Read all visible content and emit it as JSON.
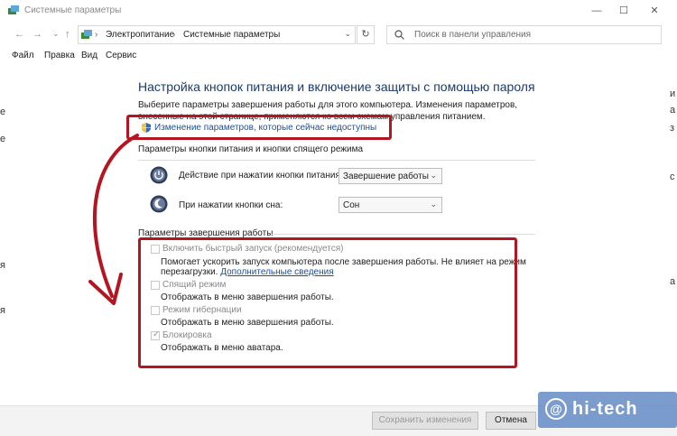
{
  "window": {
    "title": "Системные параметры",
    "controls": {
      "minimize": "—",
      "maximize": "☐",
      "close": "✕"
    }
  },
  "nav": {
    "back": "←",
    "forward": "→",
    "dropdown": "⌄",
    "up": "↑",
    "breadcrumb": [
      "Электропитание",
      "Системные параметры"
    ],
    "breadcrumb_sep": "›",
    "addr_dropdown": "⌄",
    "refresh": "↻"
  },
  "search": {
    "placeholder": "Поиск в панели управления"
  },
  "menu": [
    "Файл",
    "Правка",
    "Вид",
    "Сервис"
  ],
  "edge_left": [
    "е",
    "е",
    "я",
    "я"
  ],
  "edge_right": [
    "и",
    "а",
    "з",
    "с",
    "а"
  ],
  "page": {
    "title": "Настройка кнопок питания и включение защиты с помощью пароля",
    "intro": "Выберите параметры завершения работы для этого компьютера. Изменения параметров, внесенные на этой странице, применяются ко всем схемам управления питанием.",
    "change_link": "Изменение параметров, которые сейчас недоступны"
  },
  "power_buttons": {
    "header": "Параметры кнопки питания и кнопки спящего режима",
    "power": {
      "label": "Действие при нажатии кнопки питания:",
      "value": "Завершение работы"
    },
    "sleep": {
      "label": "При нажатии кнопки сна:",
      "value": "Сон"
    },
    "chevron": "⌄"
  },
  "shutdown": {
    "header": "Параметры завершения работы",
    "fast_startup": {
      "label": "Включить быстрый запуск (рекомендуется)",
      "desc1": "Помогает ускорить запуск компьютера после завершения работы. Не влияет на режим",
      "desc2": "перезагрузки.",
      "more": "Дополнительные сведения",
      "checked": false
    },
    "sleep": {
      "label": "Спящий режим",
      "desc": "Отображать в меню завершения работы.",
      "checked": false
    },
    "hibernate": {
      "label": "Режим гибернации",
      "desc": "Отображать в меню завершения работы.",
      "checked": false
    },
    "lock": {
      "label": "Блокировка",
      "desc": "Отображать в меню аватара.",
      "checked": true,
      "check_glyph": "✓"
    }
  },
  "footer": {
    "save": "Сохранить изменения",
    "cancel": "Отмена"
  },
  "watermark": {
    "at": "@",
    "text": "hi-tech"
  },
  "colors": {
    "highlight": "#b51521",
    "link": "#1a4f9c",
    "title": "#1a3a6e"
  }
}
